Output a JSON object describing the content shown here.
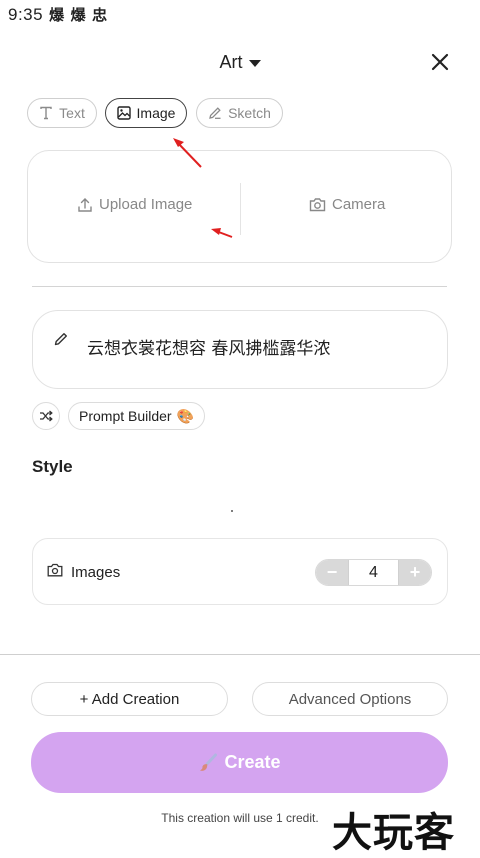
{
  "status_bar": {
    "time": "9:35",
    "notif_icons": [
      "爆",
      "爆",
      "忠"
    ]
  },
  "header": {
    "mode_label": "Art"
  },
  "tabs": [
    {
      "label": "Text",
      "icon": "text-icon",
      "active": false
    },
    {
      "label": "Image",
      "icon": "image-icon",
      "active": true
    },
    {
      "label": "Sketch",
      "icon": "pencil-icon",
      "active": false
    }
  ],
  "upload": {
    "upload_label": "Upload Image",
    "camera_label": "Camera"
  },
  "prompt": {
    "text": "云想衣裳花想容 春风拂槛露华浓"
  },
  "prompt_builder": {
    "label": "Prompt Builder",
    "emoji": "🎨"
  },
  "style": {
    "heading": "Style"
  },
  "images": {
    "label": "Images",
    "count": "4",
    "minus": "−",
    "plus": "+"
  },
  "actions": {
    "add_creation": "+ Add Creation",
    "advanced_options": "Advanced Options"
  },
  "create": {
    "label": "Create",
    "credit_note": "This creation will use 1 credit."
  },
  "watermark": "大玩客",
  "colors": {
    "create_bg": "#d4a4f0",
    "stepper_btn": "#d9d9d9",
    "annotation_arrow": "#e02020"
  }
}
